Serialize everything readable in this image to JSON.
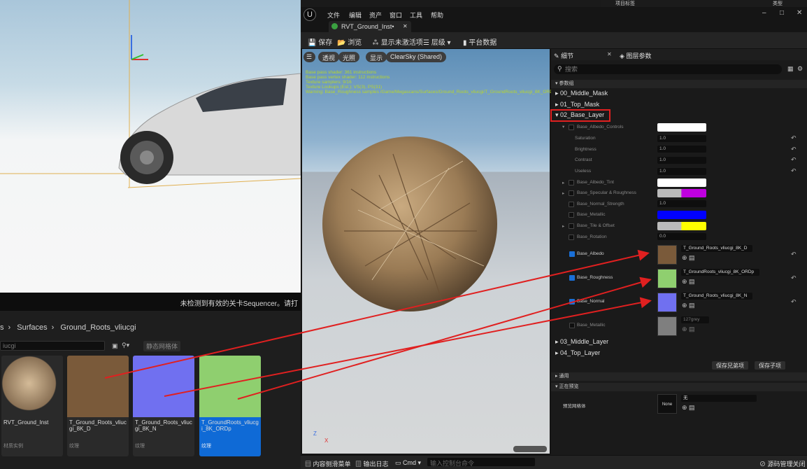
{
  "top_right": {
    "project_tags": "项目标签",
    "type": "类型"
  },
  "left_viewport": {
    "status": "未检测到有效的关卡Sequencer。请打"
  },
  "content_browser": {
    "breadcrumb": [
      "s",
      "Surfaces",
      "Ground_Roots_vliucgi"
    ],
    "search_placeholder": "iucgi",
    "static_mesh_label": "静态网格体",
    "assets": [
      {
        "name": "RVT_Ground_Inst",
        "type": "材质实例"
      },
      {
        "name": "T_Ground_Roots_vliucgi_8K_D",
        "type": "纹理"
      },
      {
        "name": "T_Ground_Roots_vliucgi_8K_N",
        "type": "纹理"
      },
      {
        "name": "T_GroundRoots_vliucgi_8K_ORDp",
        "type": "纹理"
      }
    ]
  },
  "menu": {
    "items": [
      "文件",
      "编辑",
      "资产",
      "窗口",
      "工具",
      "帮助"
    ]
  },
  "tab": {
    "title": "RVT_Ground_Inst•"
  },
  "toolbar": {
    "save": "保存",
    "browse": "浏览",
    "show_inactive": "显示未激活项",
    "hierarchy": "层级",
    "platform_stats": "平台数据"
  },
  "viewport": {
    "buttons": [
      "透视",
      "光照",
      "显示",
      "ClearSky (Shared)"
    ],
    "stats": [
      "Base pass shader: 361 instructions",
      "Base pass vertex shader: 112 instructions",
      "Texture samplers: 9/16",
      "Texture Lookups (Est.): VS(3), PS(31)",
      "Warning: Base_Roughness samples /Game/Megascans/Surfaces/Ground_Roots_vliucgi/T_GroundRoots_vliucgi_8K_ORDp T_Gr"
    ]
  },
  "details": {
    "tabs": [
      "细节",
      "图层参数"
    ],
    "search_placeholder": "搜索",
    "param_group": "参数组",
    "groups": [
      "00_Middle_Mask",
      "01_Top_Mask",
      "02_Base_Layer"
    ],
    "albedo_controls": "Base_Albedo_Controls",
    "sub_params": [
      {
        "name": "Saturation",
        "value": "1.0"
      },
      {
        "name": "Brightness",
        "value": "1.0"
      },
      {
        "name": "Contrast",
        "value": "1.0"
      },
      {
        "name": "Useless",
        "value": "1.0"
      }
    ],
    "albedo_tint": "Base_Albedo_Tint",
    "spec_rough": "Base_Specular & Roughness",
    "normal_strength": {
      "name": "Base_Normal_Strength",
      "value": "1.0"
    },
    "metallic": "Base_Metallic",
    "tile_offset": "Base_Tile & Offset",
    "rotation": {
      "name": "Base_Rotation",
      "value": "0.0"
    },
    "textures": [
      {
        "name": "Base_Albedo",
        "asset": "T_Ground_Roots_vliucgi_8K_D"
      },
      {
        "name": "Base_Roughness",
        "asset": "T_GroundRoots_vliucgi_8K_ORDp"
      },
      {
        "name": "Base_Normal",
        "asset": "T_Ground_Roots_vliucgi_8K_N"
      },
      {
        "name": "Base_Metallic",
        "asset": "127grey"
      }
    ],
    "groups_after": [
      "03_Middle_Layer",
      "04_Top_Layer"
    ],
    "save_sibling": "保存兄弟项",
    "save_child": "保存子项",
    "general": "通用",
    "previewing": "正在预览",
    "preview_mesh": "预览网格体",
    "preview_none": "None",
    "preview_value": "无"
  },
  "bottom": {
    "drawer": "内容侧滑菜单",
    "output_log": "输出日志",
    "cmd": "Cmd",
    "console_placeholder": "输入控制台命令",
    "source_control": "源码管理关闭"
  },
  "colors": {
    "accent": "#1a6fd6",
    "highlight": "#e02020",
    "tint_magenta": "#c000e0",
    "metallic_blue": "#0000ff",
    "tile_yellow": "#ffff00"
  }
}
